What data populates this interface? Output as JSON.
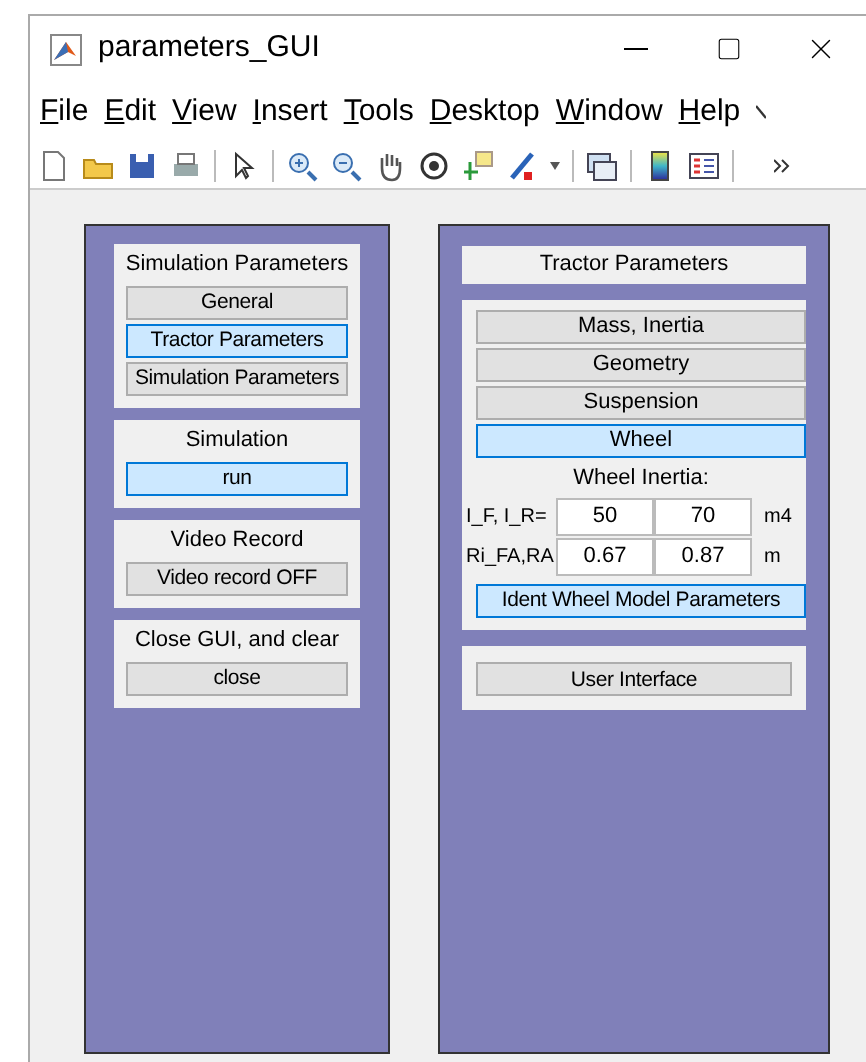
{
  "window": {
    "title": "parameters_GUI"
  },
  "menu": [
    "File",
    "Edit",
    "View",
    "Insert",
    "Tools",
    "Desktop",
    "Window",
    "Help"
  ],
  "left_panel": {
    "groups": [
      {
        "title": "Simulation Parameters",
        "buttons": [
          {
            "label": "General",
            "selected": false
          },
          {
            "label": "Tractor Parameters",
            "selected": true
          },
          {
            "label": "Simulation Parameters",
            "selected": false
          }
        ]
      },
      {
        "title": "Simulation",
        "buttons": [
          {
            "label": "run",
            "selected": true
          }
        ]
      },
      {
        "title": "Video Record",
        "buttons": [
          {
            "label": "Video record OFF",
            "selected": false
          }
        ]
      },
      {
        "title": "Close GUI, and clear",
        "buttons": [
          {
            "label": "close",
            "selected": false
          }
        ]
      }
    ]
  },
  "right_panel": {
    "title": "Tractor Parameters",
    "tabs": [
      {
        "label": "Mass, Inertia",
        "selected": false
      },
      {
        "label": "Geometry",
        "selected": false
      },
      {
        "label": "Suspension",
        "selected": false
      },
      {
        "label": "Wheel",
        "selected": true
      }
    ],
    "section_title": "Wheel Inertia:",
    "rows": [
      {
        "label": "I_F, I_R=",
        "values": [
          "50",
          "70"
        ],
        "unit": "m4"
      },
      {
        "label": "Ri_FA,RA",
        "values": [
          "0.67",
          "0.87"
        ],
        "unit": "m"
      }
    ],
    "ident_button": {
      "label": "Ident Wheel Model Parameters",
      "selected": true
    },
    "user_interface_button": {
      "label": "User Interface",
      "selected": false
    }
  }
}
